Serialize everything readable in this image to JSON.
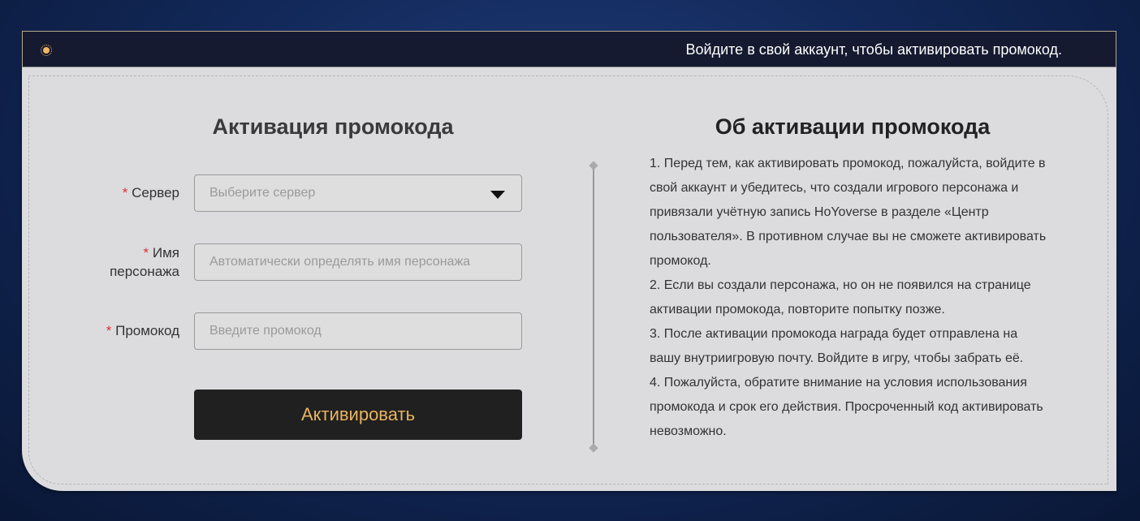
{
  "header": {
    "notice": "Войдите в свой аккаунт, чтобы активировать промокод."
  },
  "form": {
    "title": "Активация промокода",
    "required_mark": "*",
    "server": {
      "label": "Сервер",
      "placeholder": "Выберите сервер"
    },
    "character": {
      "label_line1": "Имя",
      "label_line2": "персонажа",
      "placeholder": "Автоматически определять имя персонажа"
    },
    "code": {
      "label": "Промокод",
      "placeholder": "Введите промокод"
    },
    "submit": "Активировать"
  },
  "info": {
    "title": "Об активации промокода",
    "items": [
      "1. Перед тем, как активировать промокод, пожалуйста, войдите в свой аккаунт и убедитесь, что создали игрового персонажа и привязали учётную запись HoYoverse в разделе «Центр пользователя». В противном случае вы не сможете активировать промокод.",
      "2. Если вы создали персонажа, но он не появился на странице активации промокода, повторите попытку позже.",
      "3. После активации промокода награда будет отправлена на вашу внутриигровую почту. Войдите в игру, чтобы забрать её.",
      "4. Пожалуйста, обратите внимание на условия использования промокода и срок его действия. Просроченный код активировать невозможно."
    ]
  }
}
